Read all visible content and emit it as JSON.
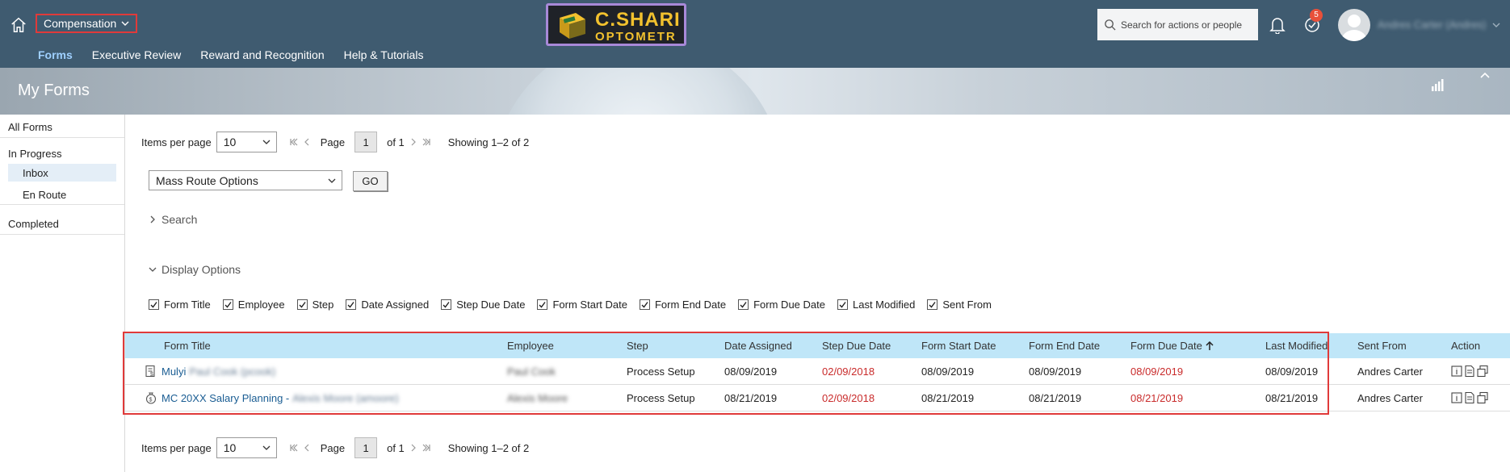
{
  "shell": {
    "module": "Compensation",
    "nav": [
      {
        "label": "Forms",
        "active": true
      },
      {
        "label": "Executive Review",
        "active": false
      },
      {
        "label": "Reward and Recognition",
        "active": false
      },
      {
        "label": "Help & Tutorials",
        "active": false
      }
    ],
    "logo_line1": "C.SHARI",
    "logo_line2": "OPTOMETR",
    "search_placeholder": "Search for actions or people",
    "todo_count": "5",
    "user_name": "Andres Carter (Andres)"
  },
  "page": {
    "title": "My Forms"
  },
  "sidebar": {
    "all_forms": "All Forms",
    "in_progress": "In Progress",
    "inbox": "Inbox",
    "en_route": "En Route",
    "completed": "Completed"
  },
  "pager": {
    "items_label": "Items per page",
    "items_value": "10",
    "page_label": "Page",
    "page_value": "1",
    "of_label": "of 1",
    "showing": "Showing 1–2 of 2"
  },
  "mass": {
    "select_value": "Mass Route Options",
    "go_label": "GO"
  },
  "search_toggle": "Search",
  "display_toggle": "Display Options",
  "display_options": [
    "Form Title",
    "Employee",
    "Step",
    "Date Assigned",
    "Step Due Date",
    "Form Start Date",
    "Form End Date",
    "Form Due Date",
    "Last Modified",
    "Sent From"
  ],
  "table": {
    "headers": {
      "form_title": "Form Title",
      "employee": "Employee",
      "step": "Step",
      "date_assigned": "Date Assigned",
      "step_due": "Step Due Date",
      "form_start": "Form Start Date",
      "form_end": "Form End Date",
      "form_due": "Form Due Date",
      "last_modified": "Last Modified",
      "sent_from": "Sent From",
      "action": "Action"
    },
    "rows": [
      {
        "title": "Mulyi",
        "title_suffix": "Paul Cook (pcook)",
        "employee": "Paul Cook",
        "step": "Process Setup",
        "date_assigned": "08/09/2019",
        "step_due": "02/09/2018",
        "form_start": "08/09/2019",
        "form_end": "08/09/2019",
        "form_due": "08/09/2019",
        "last_modified": "08/09/2019",
        "sent_from": "Andres Carter"
      },
      {
        "title": "MC 20XX Salary Planning -",
        "title_suffix": "Alexis Moore (amoore)",
        "employee": "Alexis Moore",
        "step": "Process Setup",
        "date_assigned": "08/21/2019",
        "step_due": "02/09/2018",
        "form_start": "08/21/2019",
        "form_end": "08/21/2019",
        "form_due": "08/21/2019",
        "last_modified": "08/21/2019",
        "sent_from": "Andres Carter"
      }
    ]
  }
}
